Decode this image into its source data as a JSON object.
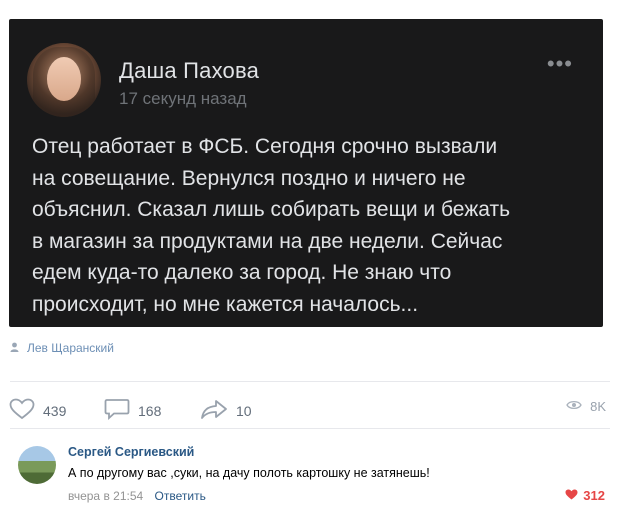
{
  "post": {
    "author": "Даша Пахова",
    "time": "17 секунд назад",
    "text": "Отец работает в ФСБ. Сегодня срочно вызвали\nна совещание. Вернулся поздно и ничего не\nобъяснил. Сказал лишь собирать вещи и бежать\nв магазин за продуктами на две недели. Сейчас\nедем куда-то далеко за город. Не знаю что\nпроисходит, но мне кажется началось...",
    "more_icon": "more-icon"
  },
  "source": {
    "name": "Лев Щаранский"
  },
  "actions": {
    "likes": "439",
    "comments": "168",
    "shares": "10",
    "views": "8K"
  },
  "comment": {
    "author": "Сергей Сергиевский",
    "text": "А по другому вас ,суки, на дачу полоть картошку не затянешь!",
    "time": "вчера в 21:54",
    "reply_label": "Ответить",
    "likes": "312"
  },
  "colors": {
    "card_bg": "#19191a",
    "link": "#2a5885",
    "like_active": "#e64646",
    "muted": "#818c99"
  }
}
